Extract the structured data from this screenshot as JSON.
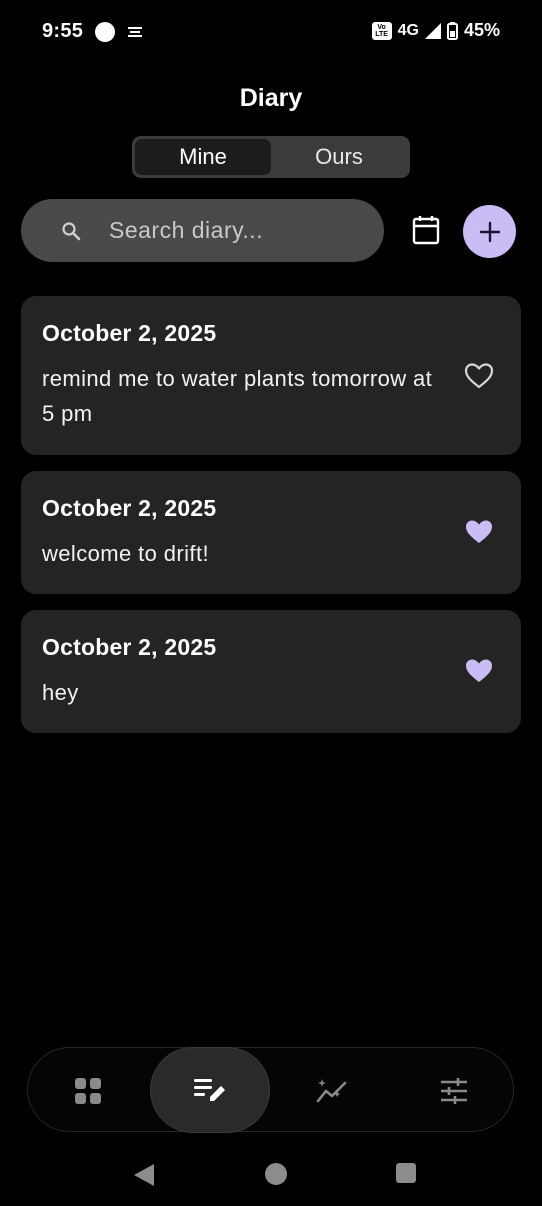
{
  "status_bar": {
    "time": "9:55",
    "network": "4G",
    "battery": "45%",
    "volte_top": "Vo",
    "volte_bottom": "LTE"
  },
  "header": {
    "title": "Diary",
    "tabs": [
      {
        "label": "Mine",
        "active": true
      },
      {
        "label": "Ours",
        "active": false
      }
    ]
  },
  "search": {
    "placeholder": "Search diary..."
  },
  "accent_color": "#cbbcf6",
  "entries": [
    {
      "date": "October 2, 2025",
      "text": "remind me to water plants tomorrow at 5 pm",
      "favorite": false
    },
    {
      "date": "October 2, 2025",
      "text": "welcome to drift!",
      "favorite": true
    },
    {
      "date": "October 2, 2025",
      "text": "hey",
      "favorite": true
    }
  ],
  "bottom_nav": {
    "items": [
      {
        "icon": "grid-icon",
        "active": false
      },
      {
        "icon": "edit-note-icon",
        "active": true
      },
      {
        "icon": "sparkle-chart-icon",
        "active": false
      },
      {
        "icon": "sliders-icon",
        "active": false
      }
    ]
  },
  "system_nav": {
    "icons": [
      "back-icon",
      "home-icon",
      "recents-icon"
    ]
  }
}
